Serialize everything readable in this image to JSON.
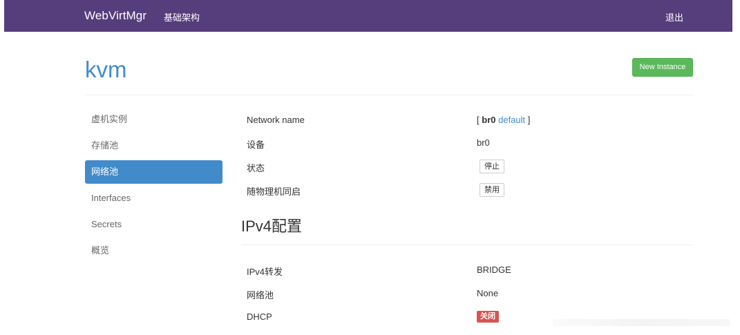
{
  "navbar": {
    "brand": "WebVirtMgr",
    "link": "基础架构",
    "logout": "退出",
    "bg_color": "#563d7c"
  },
  "header": {
    "title": "kvm",
    "new_instance_label": "New Instance",
    "accent_color": "#428bca",
    "button_color": "#5cb85c"
  },
  "sidebar": {
    "items": [
      {
        "label": "虚机实例",
        "active": false
      },
      {
        "label": "存储池",
        "active": false
      },
      {
        "label": "网络池",
        "active": true
      },
      {
        "label": "Interfaces",
        "active": false
      },
      {
        "label": "Secrets",
        "active": false
      },
      {
        "label": "概览",
        "active": false
      }
    ]
  },
  "network": {
    "name_label": "Network name",
    "name_bracket_open": "[",
    "name_value": "br0",
    "name_link": "default",
    "name_bracket_close": "]",
    "device_label": "设备",
    "device_value": "br0",
    "state_label": "状态",
    "state_button": "停止",
    "autostart_label": "随物理机同启",
    "autostart_button": "禁用"
  },
  "ipv4": {
    "section_title": "IPv4配置",
    "forward_label": "IPv4转发",
    "forward_value": "BRIDGE",
    "pool_label": "网络池",
    "pool_value": "None",
    "dhcp_label": "DHCP",
    "dhcp_status": "关闭",
    "dhcp_status_color": "#d9534f"
  }
}
